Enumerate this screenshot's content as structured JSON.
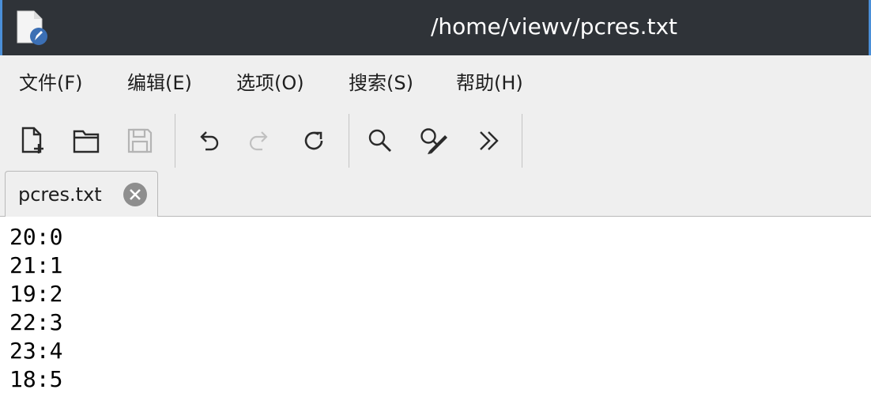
{
  "window": {
    "title": "/home/viewv/pcres.txt"
  },
  "menubar": {
    "items": [
      {
        "label": "文件(F)"
      },
      {
        "label": "编辑(E)"
      },
      {
        "label": "选项(O)"
      },
      {
        "label": "搜索(S)"
      },
      {
        "label": "帮助(H)"
      }
    ]
  },
  "toolbar": {
    "buttons": [
      {
        "icon": "new-file-icon"
      },
      {
        "icon": "open-folder-icon"
      },
      {
        "icon": "save-icon",
        "disabled": true
      },
      {
        "icon": "undo-icon"
      },
      {
        "icon": "redo-icon",
        "disabled": true
      },
      {
        "icon": "reload-icon"
      },
      {
        "icon": "search-icon"
      },
      {
        "icon": "search-replace-icon"
      },
      {
        "icon": "more-icon"
      }
    ]
  },
  "tabs": [
    {
      "label": "pcres.txt",
      "active": true
    }
  ],
  "editor": {
    "lines": [
      "20:0",
      "21:1",
      "19:2",
      "22:3",
      "23:4",
      "18:5"
    ]
  },
  "colors": {
    "titlebar": "#2f3338",
    "accent": "#4a8fd8",
    "chrome": "#efefef",
    "editor_bg": "#ffffff"
  }
}
